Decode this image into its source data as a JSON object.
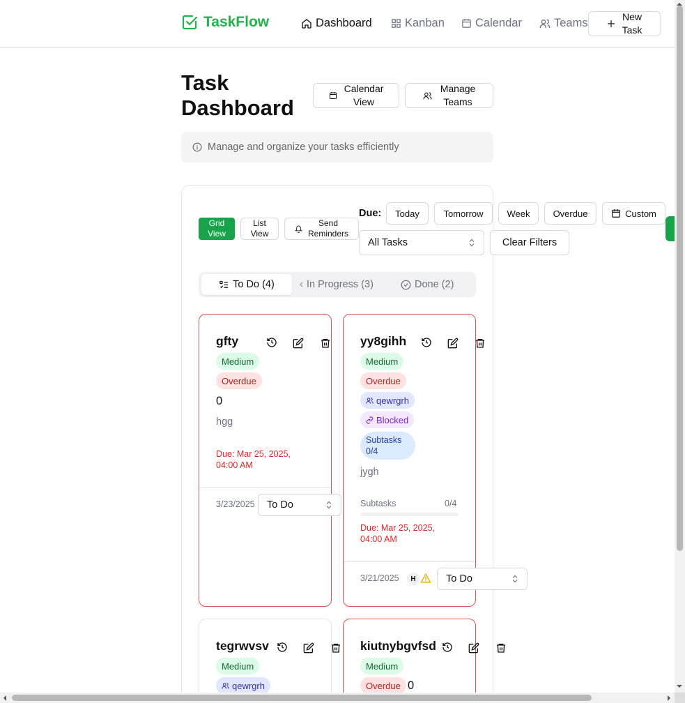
{
  "brand": {
    "name": "TaskFlow",
    "color": "#22b34b"
  },
  "nav": {
    "items": [
      {
        "label": "Dashboard",
        "icon": "home-icon",
        "active": true
      },
      {
        "label": "Kanban",
        "icon": "grid-icon"
      },
      {
        "label": "Calendar",
        "icon": "calendar-icon"
      },
      {
        "label": "Teams",
        "icon": "users-icon"
      }
    ],
    "new_task_label_1": "New",
    "new_task_label_2": "Task"
  },
  "page": {
    "title": "Task Dashboard",
    "calendar_view_1": "Calendar",
    "calendar_view_2": "View",
    "manage_teams_1": "Manage",
    "manage_teams_2": "Teams",
    "info_text": "Manage and organize your tasks efficiently"
  },
  "toolbar": {
    "grid_view_1": "Grid",
    "grid_view_2": "View",
    "list_view_1": "List",
    "list_view_2": "View",
    "send_reminders_1": "Send",
    "send_reminders_2": "Reminders",
    "due_label": "Due:",
    "due_options": [
      "Today",
      "Tomorrow",
      "Week",
      "Overdue",
      "Custom"
    ],
    "filter_select": "All Tasks",
    "clear_filters": "Clear Filters"
  },
  "tabs": [
    {
      "label": "To Do (4)",
      "active": true
    },
    {
      "label": "In Progress (3)"
    },
    {
      "label": "Done (2)"
    }
  ],
  "colors": {
    "accent": "#16a34a",
    "overdue_border": "#e05252",
    "danger": "#dc2626"
  },
  "cards": [
    {
      "title": "gfty",
      "priority": "Medium",
      "status_badge": "Overdue",
      "count": "0",
      "description": "hgg",
      "due_1": "Due: Mar 25, 2025,",
      "due_2": "04:00 AM",
      "created": "3/23/2025",
      "status": "To Do"
    },
    {
      "title": "yy8gihh",
      "priority": "Medium",
      "status_badge": "Overdue",
      "team": "qewrgrh",
      "blocked": "Blocked",
      "subtasks_badge_1": "Subtasks",
      "subtasks_badge_2": "0/4",
      "description": "jygh",
      "subtasks_label": "Subtasks",
      "subtasks_count": "0/4",
      "subtasks_progress": 0,
      "due_1": "Due: Mar 25, 2025,",
      "due_2": "04:00 AM",
      "created": "3/21/2025",
      "avatar": "H",
      "status": "To Do"
    },
    {
      "title": "tegrwvsv",
      "priority": "Medium",
      "team": "qewrgrh"
    },
    {
      "title": "kiutnybgvfsd",
      "priority": "Medium",
      "status_badge": "Overdue",
      "count": "0"
    }
  ]
}
